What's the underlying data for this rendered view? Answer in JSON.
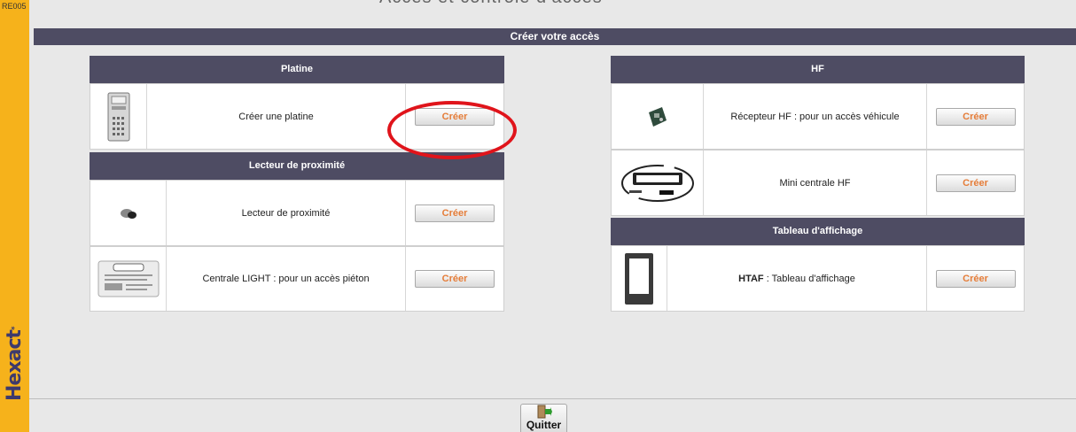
{
  "app": {
    "screen_code": "RE005",
    "brand": "Hexact",
    "top_title": "Accès et contrôle d’accès"
  },
  "header": {
    "title": "Créer votre accès"
  },
  "left": {
    "platine": {
      "title": "Platine",
      "rows": [
        {
          "label": "Créer une platine",
          "button": "Créer",
          "icon": "platine-keypad-icon"
        }
      ]
    },
    "proximite": {
      "title": "Lecteur de proximité",
      "rows": [
        {
          "label": "Lecteur de proximité",
          "button": "Créer",
          "icon": "proximity-reader-icon"
        },
        {
          "label": "Centrale LIGHT : pour un accès piéton",
          "button": "Créer",
          "icon": "centrale-light-icon"
        }
      ]
    }
  },
  "right": {
    "hf": {
      "title": "HF",
      "rows": [
        {
          "label": "Récepteur HF : pour un accès véhicule",
          "button": "Créer",
          "icon": "hf-receiver-icon"
        },
        {
          "label": "Mini centrale HF",
          "button": "Créer",
          "icon": "hexact-plus-hf-logo"
        }
      ]
    },
    "tableau": {
      "title": "Tableau d'affichage",
      "rows": [
        {
          "label_bold": "HTAF",
          "label_rest": " : Tableau d'affichage",
          "button": "Créer",
          "icon": "display-panel-icon"
        }
      ]
    }
  },
  "footer": {
    "quit_label": "Quitter",
    "quit_icon": "exit-door-icon"
  },
  "highlight": {
    "color": "#e0141b"
  }
}
